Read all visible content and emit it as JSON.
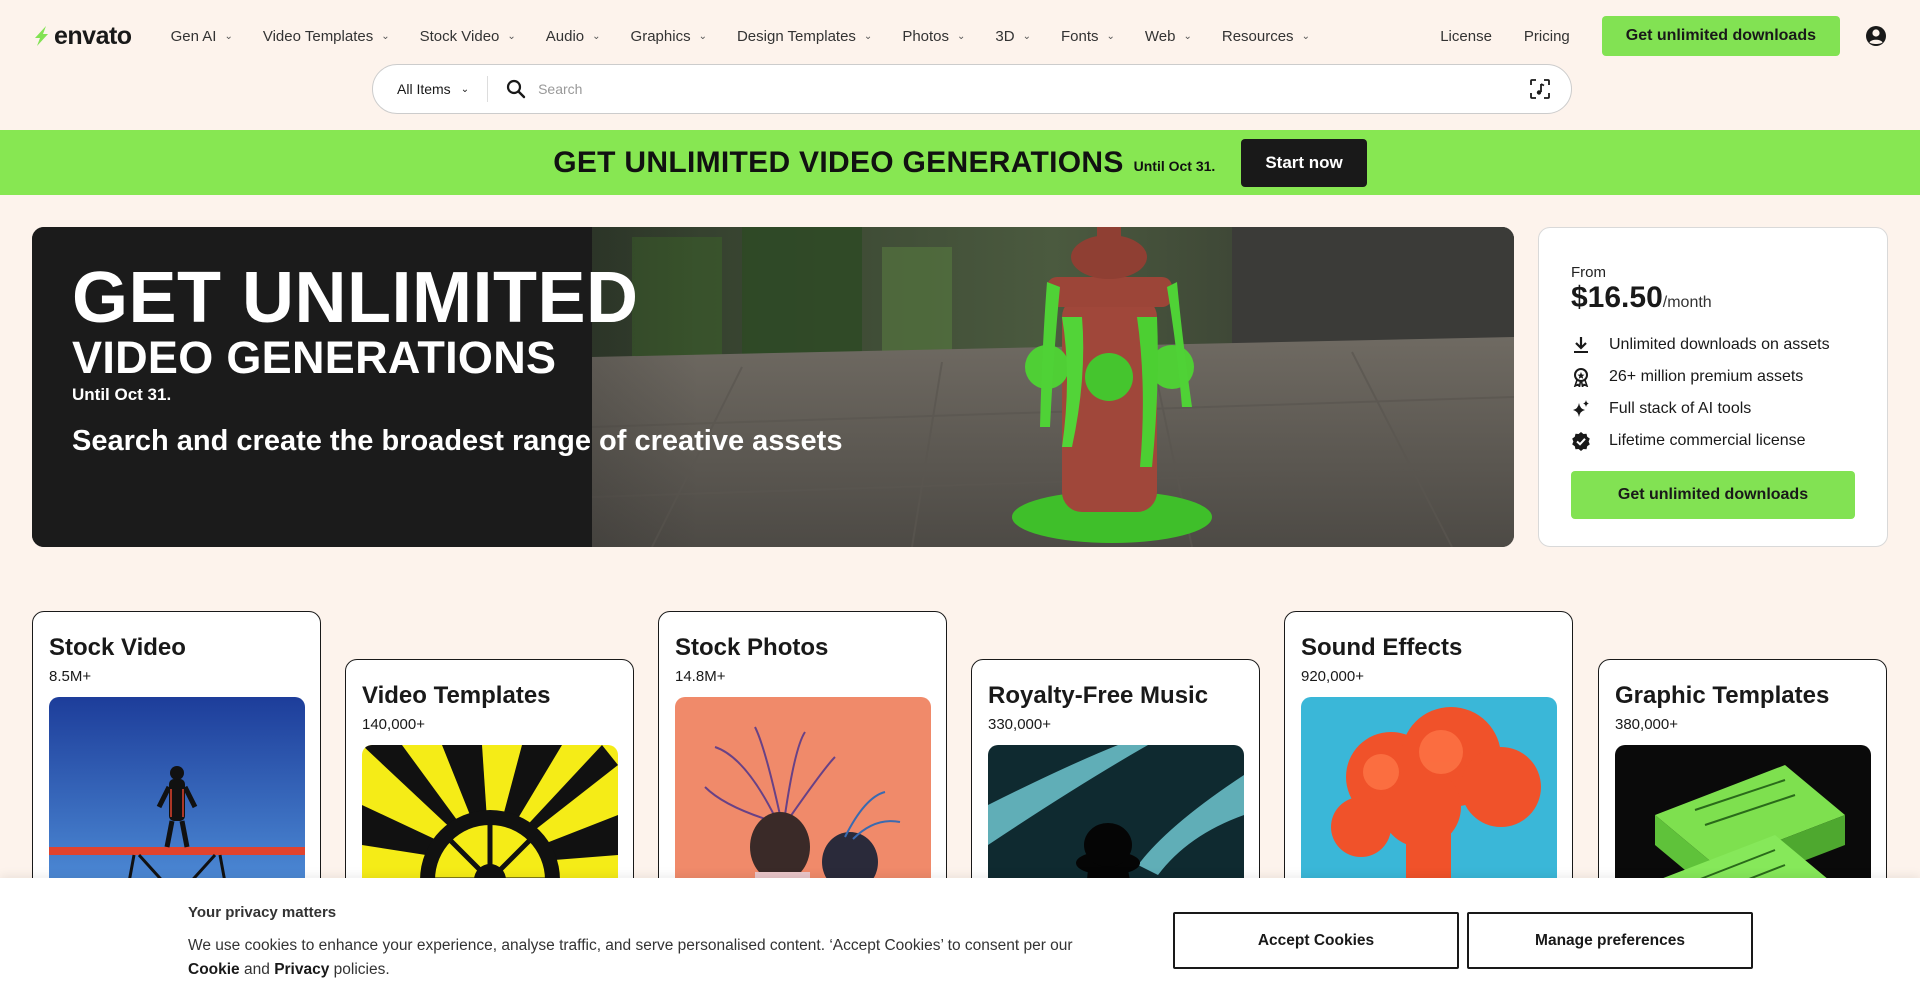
{
  "header": {
    "logo_text": "envato",
    "nav": [
      {
        "label": "Gen AI"
      },
      {
        "label": "Video Templates"
      },
      {
        "label": "Stock Video"
      },
      {
        "label": "Audio"
      },
      {
        "label": "Graphics"
      },
      {
        "label": "Design Templates"
      },
      {
        "label": "Photos"
      },
      {
        "label": "3D"
      },
      {
        "label": "Fonts"
      },
      {
        "label": "Web"
      },
      {
        "label": "Resources"
      }
    ],
    "license": "License",
    "pricing": "Pricing",
    "cta": "Get unlimited downloads"
  },
  "search": {
    "category": "All Items",
    "placeholder": "Search",
    "value": ""
  },
  "promo": {
    "title": "GET UNLIMITED VIDEO GENERATIONS",
    "until": "Until Oct 31.",
    "button": "Start now"
  },
  "hero": {
    "line1": "GET UNLIMITED",
    "line2": "VIDEO GENERATIONS",
    "until": "Until Oct 31.",
    "tagline": "Search and create the broadest range of creative assets"
  },
  "pricing_card": {
    "from": "From",
    "amount": "$16.50",
    "per": "/month",
    "features": [
      {
        "icon": "download-icon",
        "text": "Unlimited downloads on assets"
      },
      {
        "icon": "award-icon",
        "text": "26+ million premium assets"
      },
      {
        "icon": "sparkle-icon",
        "text": "Full stack of AI tools"
      },
      {
        "icon": "check-badge-icon",
        "text": "Lifetime commercial license"
      }
    ],
    "cta": "Get unlimited downloads"
  },
  "categories": [
    {
      "title": "Stock Video",
      "count": "8.5M+"
    },
    {
      "title": "Video Templates",
      "count": "140,000+"
    },
    {
      "title": "Stock Photos",
      "count": "14.8M+"
    },
    {
      "title": "Royalty-Free Music",
      "count": "330,000+"
    },
    {
      "title": "Sound Effects",
      "count": "920,000+"
    },
    {
      "title": "Graphic Templates",
      "count": "380,000+"
    }
  ],
  "cookie": {
    "title": "Your privacy matters",
    "text": "We use cookies to enhance your experience, analyse traffic, and serve personalised content. ‘Accept Cookies’ to consent per our",
    "cookie_link": "Cookie",
    "and": "and",
    "privacy_link": "Privacy",
    "policies": "policies.",
    "accept": "Accept Cookies",
    "manage": "Manage preferences"
  },
  "colors": {
    "brand_green": "#82e253",
    "background": "#fdf3ec",
    "dark": "#191919"
  }
}
